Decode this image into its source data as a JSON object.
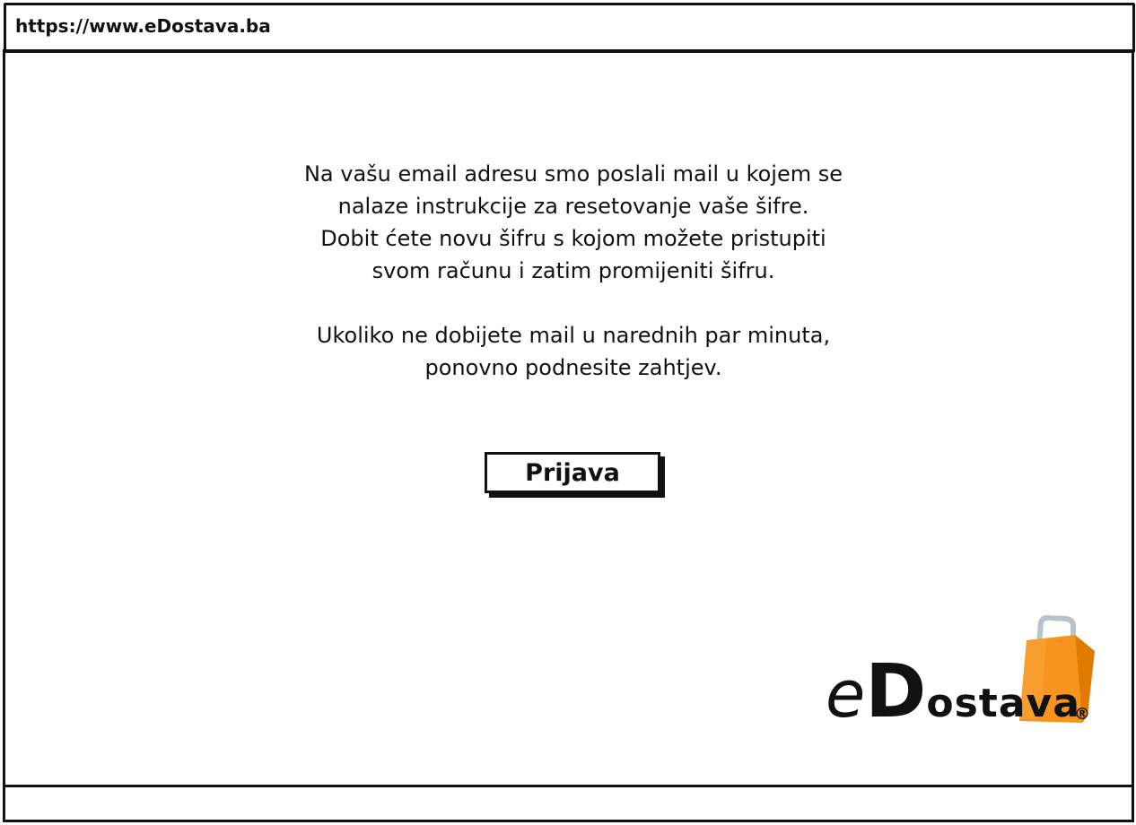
{
  "browser": {
    "url": "https://www.eDostava.ba"
  },
  "main": {
    "message_lines": [
      "Na vašu email adresu smo poslali mail u kojem se",
      "nalaze instrukcije za resetovanje vaše šifre.",
      "Dobit ćete novu šifru s kojom možete pristupiti",
      "svom računu i zatim promijeniti šifru."
    ],
    "note_lines": [
      "Ukoliko ne dobijete mail u narednih par minuta,",
      "ponovno podnesite zahtjev."
    ],
    "login_button_label": "Prijava"
  },
  "logo": {
    "letter_e": "e",
    "letter_d": "D",
    "rest": "ostava",
    "registered": "®",
    "bag_color": "#F7941D",
    "bag_dark_color": "#E07B00",
    "handle_color": "#B8C4CC",
    "icon": "shopping-bag-icon"
  },
  "colors": {
    "border": "#111111",
    "background": "#FFFFFF"
  }
}
